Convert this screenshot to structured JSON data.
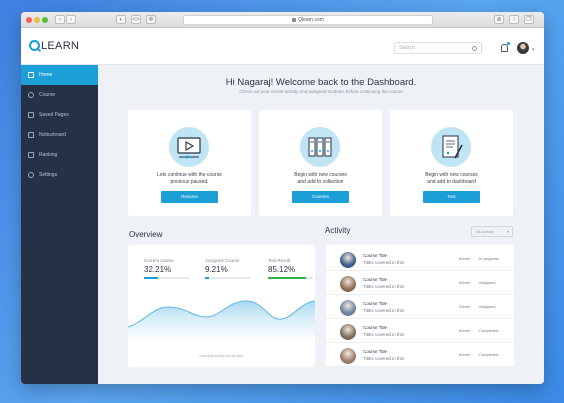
{
  "browser": {
    "url": "Qlearn.com"
  },
  "header": {
    "logo_text": "LEARN",
    "search_placeholder": "Search"
  },
  "sidebar": {
    "items": [
      {
        "label": "Home",
        "active": true
      },
      {
        "label": "Course",
        "active": false
      },
      {
        "label": "Saved Pages",
        "active": false
      },
      {
        "label": "Noticeboard",
        "active": false
      },
      {
        "label": "Ranking",
        "active": false
      },
      {
        "label": "Settings",
        "active": false
      }
    ]
  },
  "main": {
    "welcome_title": "Hi Nagaraj! Welcome back to the Dashboard.",
    "welcome_subtitle": "Check out your recent activity and assigned modules before continuing the course",
    "cards": [
      {
        "icon": "video-player-icon",
        "line1": "Lets continue with the course",
        "line2": "previous paused.",
        "button": "Resume"
      },
      {
        "icon": "binders-icon",
        "line1": "Begin with new courses",
        "line2": "and add to collection",
        "button": "Courses"
      },
      {
        "icon": "document-pen-icon",
        "line1": "Begin with new courses",
        "line2": "and add to dashboard",
        "button": "Test"
      }
    ]
  },
  "overview": {
    "title": "Overview",
    "stats": [
      {
        "label": "Current course",
        "value": "32.21%",
        "fill": 0.32,
        "color": "#1b9fd6"
      },
      {
        "label": "Assigned Course",
        "value": "9.21%",
        "fill": 0.09,
        "color": "#1b9fd6"
      },
      {
        "label": "Test Result",
        "value": "85.12%",
        "fill": 0.85,
        "color": "#2fb14d"
      }
    ],
    "chart_caption": "Learning activity for the year"
  },
  "activity": {
    "title": "Activity",
    "filter": "All Activity",
    "rows": [
      {
        "title": "Course Title",
        "subtitle": "Titles covered in this",
        "duration": "60min",
        "status": "In progress",
        "thumb": "#3a5a8a"
      },
      {
        "title": "Course Title",
        "subtitle": "Titles covered in this",
        "duration": "30min",
        "status": "Assigned",
        "thumb": "#8a6a4a"
      },
      {
        "title": "Course Title",
        "subtitle": "Titles covered in this",
        "duration": "20min",
        "status": "Assigned",
        "thumb": "#6a7fa0"
      },
      {
        "title": "Course Title",
        "subtitle": "Titles covered in this",
        "duration": "60min",
        "status": "Completed",
        "thumb": "#7a6a5a"
      },
      {
        "title": "Course Title",
        "subtitle": "Titles covered in this",
        "duration": "60min",
        "status": "Completed",
        "thumb": "#9a7a6a"
      }
    ]
  }
}
